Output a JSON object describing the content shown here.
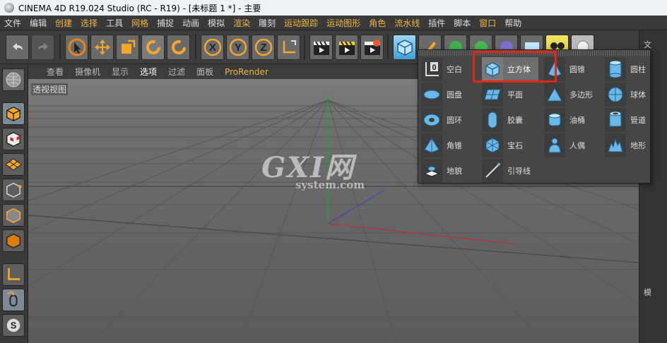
{
  "window": {
    "title": "CINEMA 4D R19.024 Studio (RC - R19) - [未标题 1 *] - 主要"
  },
  "menu": [
    "文件",
    "编辑",
    "创建",
    "选择",
    "工具",
    "网格",
    "捕捉",
    "动画",
    "模拟",
    "渲染",
    "雕刻",
    "运动跟踪",
    "运动图形",
    "角色",
    "流水线",
    "插件",
    "脚本",
    "窗口",
    "帮助"
  ],
  "viewport_menu": {
    "items": [
      "查看",
      "摄像机",
      "显示",
      "选项",
      "过滤",
      "面板"
    ],
    "prorender": "ProRender",
    "view_label": "透视视图"
  },
  "dropdown": {
    "items": [
      {
        "label": "空白",
        "icon": "null-icon"
      },
      {
        "label": "立方体",
        "icon": "cube-icon",
        "selected": true
      },
      {
        "label": "圆锥",
        "icon": "cone-icon"
      },
      {
        "label": "圆柱",
        "icon": "cylinder-icon"
      },
      {
        "label": "圆盘",
        "icon": "disc-icon"
      },
      {
        "label": "平面",
        "icon": "plane-icon"
      },
      {
        "label": "多边形",
        "icon": "polygon-icon"
      },
      {
        "label": "球体",
        "icon": "sphere-icon"
      },
      {
        "label": "圆环",
        "icon": "torus-icon"
      },
      {
        "label": "胶囊",
        "icon": "capsule-icon"
      },
      {
        "label": "油桶",
        "icon": "oil-tank-icon"
      },
      {
        "label": "管道",
        "icon": "tube-icon"
      },
      {
        "label": "角锥",
        "icon": "pyramid-icon"
      },
      {
        "label": "宝石",
        "icon": "platonic-icon"
      },
      {
        "label": "人偶",
        "icon": "figure-icon"
      },
      {
        "label": "地形",
        "icon": "landscape-icon"
      },
      {
        "label": "地貌",
        "icon": "relief-icon"
      },
      {
        "label": "引导线",
        "icon": "guide-icon"
      }
    ]
  },
  "right_panel": {
    "top_title": "文",
    "bottom_title": "模"
  },
  "watermark": {
    "big": "GXI网",
    "small": "system.com"
  },
  "colors": {
    "highlight": "#e0261b",
    "accent": "#f0b441",
    "axis_x": "#c62b2b",
    "axis_y": "#2ea02e",
    "axis_z": "#3a3ad0"
  }
}
